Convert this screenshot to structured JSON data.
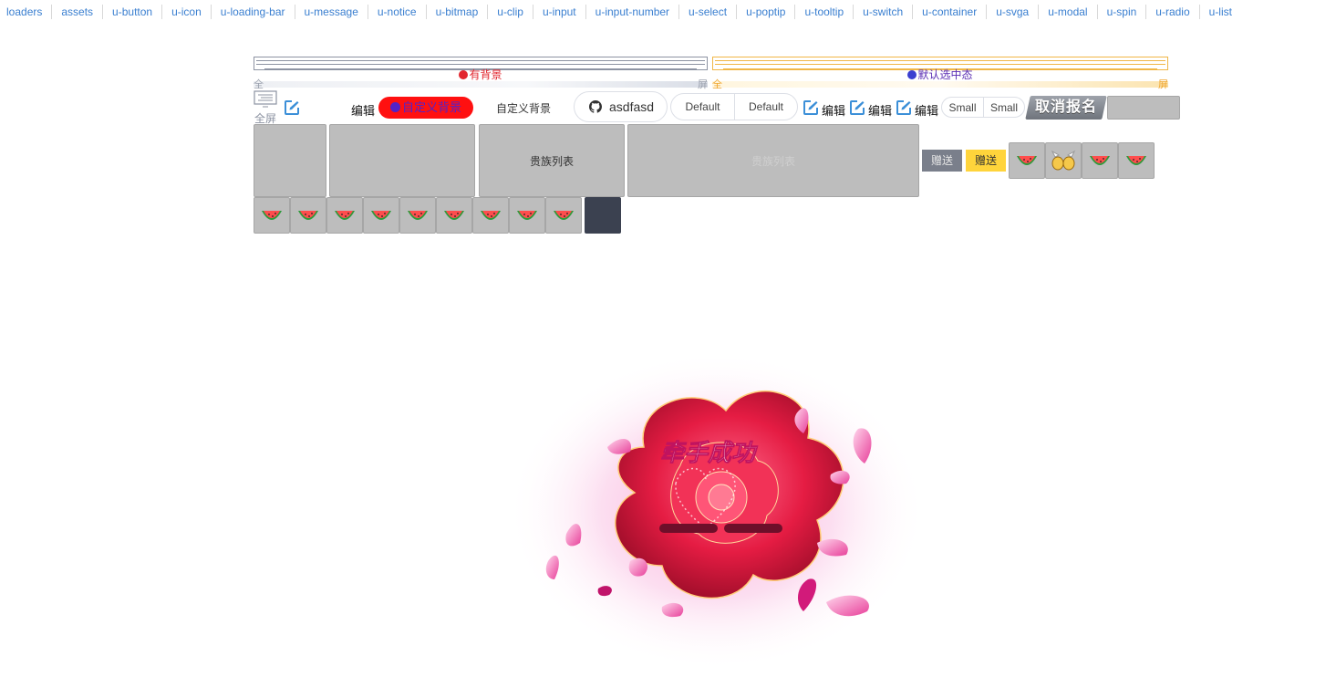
{
  "nav": [
    "loaders",
    "assets",
    "u-button",
    "u-icon",
    "u-loading-bar",
    "u-message",
    "u-notice",
    "u-bitmap",
    "u-clip",
    "u-input",
    "u-input-number",
    "u-select",
    "u-poptip",
    "u-tooltip",
    "u-switch",
    "u-container",
    "u-svga",
    "u-modal",
    "u-spin",
    "u-radio",
    "u-list"
  ],
  "bar1": {
    "label": "有背景",
    "corner_left": "全",
    "corner_right": "屏"
  },
  "bar2": {
    "label": "默认选中态",
    "corner_left": "全",
    "corner_right": "屏"
  },
  "row2": {
    "fullscreen_label": "全屏",
    "edit_label_1": "编辑",
    "custom_bg_pill": "自定义背景",
    "custom_bg_text": "自定义背景",
    "github_input_value": "asdfasd",
    "default_buttons": [
      "Default",
      "Default"
    ],
    "edit_labels": [
      "编辑",
      "编辑",
      "编辑"
    ],
    "small_buttons": [
      "Small",
      "Small"
    ],
    "cancel_signup": "取消报名"
  },
  "row3": {
    "box3_label": "贵族列表",
    "box4_label": "贵族列表",
    "gift_gray": "赠送",
    "gift_yellow": "赠送"
  },
  "rose": {
    "title": "牵手成功"
  },
  "icons": {
    "github": "github-icon",
    "edit": "edit-square-icon",
    "fullscreen": "fullscreen-icon",
    "watermelon": "watermelon-icon",
    "candy": "candy-wings-icon"
  },
  "colors": {
    "nav_link": "#3a7fd0",
    "pill_red": "#ff1010",
    "gift_yellow": "#ffd43b",
    "tile_gray": "#bdbdbd",
    "edit_blue": "#3b8fd8"
  }
}
